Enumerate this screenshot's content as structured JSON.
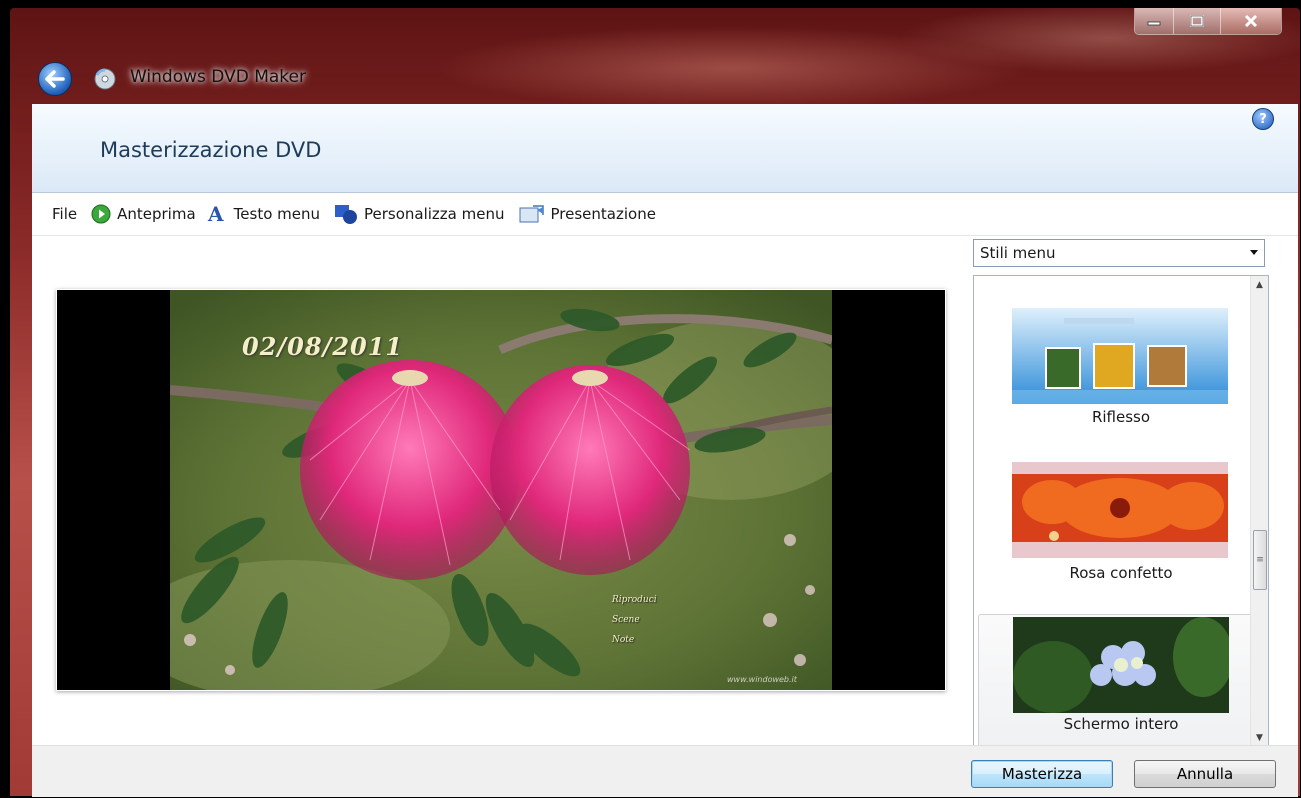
{
  "window": {
    "app_title": "Windows DVD Maker",
    "minimize_icon": "minimize-icon",
    "maximize_icon": "maximize-icon",
    "close_icon": "close-icon"
  },
  "header": {
    "page_title": "Masterizzazione DVD"
  },
  "toolbar": {
    "file": "File",
    "preview": "Anteprima",
    "menu_text": "Testo menu",
    "customize_menu": "Personalizza menu",
    "slideshow": "Presentazione"
  },
  "preview": {
    "date_text": "02/08/2011",
    "menu_items": [
      "Riproduci",
      "Scene",
      "Note"
    ],
    "watermark": "www.windoweb.it"
  },
  "styles": {
    "select_value": "Stili menu",
    "items": [
      {
        "label": "Riflesso",
        "selected": false
      },
      {
        "label": "Rosa confetto",
        "selected": false
      },
      {
        "label": "Schermo intero",
        "selected": true
      }
    ]
  },
  "footer": {
    "burn_button": "Masterizza",
    "cancel_button": "Annulla"
  },
  "colors": {
    "header_band": "#dbe9f7",
    "title_text": "#1e3b5a",
    "accent_arrow": "#e01010",
    "default_button_border": "#3c7fb1"
  }
}
